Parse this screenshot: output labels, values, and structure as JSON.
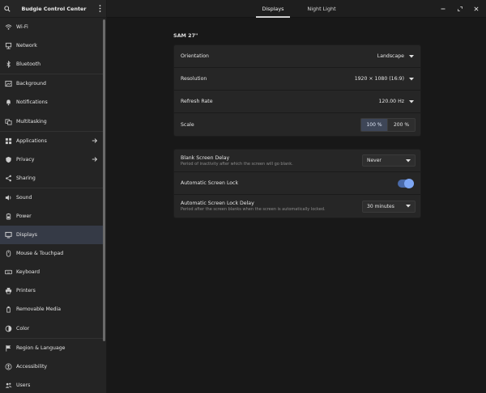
{
  "window": {
    "title": "Budgie Control Center"
  },
  "sidebar": {
    "items": [
      {
        "label": "Wi-Fi",
        "icon": "wifi-icon"
      },
      {
        "label": "Network",
        "icon": "network-icon"
      },
      {
        "label": "Bluetooth",
        "icon": "bluetooth-icon"
      },
      {
        "label": "Background",
        "icon": "background-icon"
      },
      {
        "label": "Notifications",
        "icon": "bell-icon"
      },
      {
        "label": "Multitasking",
        "icon": "multitasking-icon"
      },
      {
        "label": "Applications",
        "icon": "applications-icon",
        "arrow": true
      },
      {
        "label": "Privacy",
        "icon": "privacy-icon",
        "arrow": true
      },
      {
        "label": "Sharing",
        "icon": "share-icon"
      },
      {
        "label": "Sound",
        "icon": "speaker-icon"
      },
      {
        "label": "Power",
        "icon": "power-icon"
      },
      {
        "label": "Displays",
        "icon": "display-icon",
        "selected": true
      },
      {
        "label": "Mouse & Touchpad",
        "icon": "mouse-icon"
      },
      {
        "label": "Keyboard",
        "icon": "keyboard-icon"
      },
      {
        "label": "Printers",
        "icon": "printer-icon"
      },
      {
        "label": "Removable Media",
        "icon": "removable-media-icon"
      },
      {
        "label": "Color",
        "icon": "color-icon"
      },
      {
        "label": "Region & Language",
        "icon": "flag-icon"
      },
      {
        "label": "Accessibility",
        "icon": "accessibility-icon"
      },
      {
        "label": "Users",
        "icon": "users-icon"
      }
    ]
  },
  "tabs": [
    {
      "label": "Displays",
      "active": true
    },
    {
      "label": "Night Light",
      "active": false
    }
  ],
  "monitor": {
    "name": "SAM 27\""
  },
  "display_settings": {
    "orientation": {
      "label": "Orientation",
      "value": "Landscape"
    },
    "resolution": {
      "label": "Resolution",
      "value": "1920 × 1080 (16:9)"
    },
    "refresh": {
      "label": "Refresh Rate",
      "value": "120.00 Hz"
    },
    "scale": {
      "label": "Scale",
      "options": [
        "100 %",
        "200 %"
      ],
      "selected": "100 %"
    }
  },
  "screen_settings": {
    "blank_delay": {
      "label": "Blank Screen Delay",
      "sub": "Period of inactivity after which the screen will go blank.",
      "value": "Never"
    },
    "auto_lock": {
      "label": "Automatic Screen Lock",
      "enabled": true
    },
    "lock_delay": {
      "label": "Automatic Screen Lock Delay",
      "sub": "Period after the screen blanks when the screen is automatically locked.",
      "value": "30 minutes"
    }
  },
  "colors": {
    "accent": "#7ea7f4",
    "selected_row": "#353a46"
  }
}
